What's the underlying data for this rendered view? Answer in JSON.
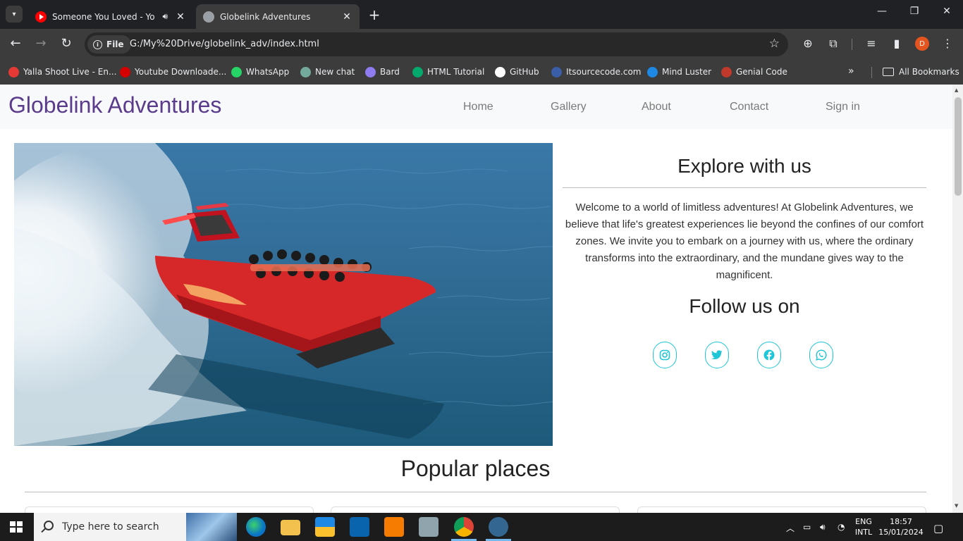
{
  "browser": {
    "tabs": [
      {
        "title": "Someone You Loved - YouTube",
        "active": false,
        "favicon": "youtube-icon",
        "audio": true
      },
      {
        "title": "Globelink Adventures",
        "active": true,
        "favicon": "globe-icon"
      }
    ],
    "address": {
      "chip_label": "File",
      "url": "G:/My%20Drive/globelink_adv/index.html"
    },
    "bookmarks": [
      {
        "label": "Yalla Shoot Live - En...",
        "color": "#e53935"
      },
      {
        "label": "Youtube Downloade...",
        "color": "#d50000"
      },
      {
        "label": "WhatsApp",
        "color": "#25d366"
      },
      {
        "label": "New chat",
        "color": "#74aa9c"
      },
      {
        "label": "Bard",
        "color": "#8e7cf0"
      },
      {
        "label": "HTML Tutorial",
        "color": "#04aa6d"
      },
      {
        "label": "GitHub",
        "color": "#ffffff"
      },
      {
        "label": "Itsourcecode.com",
        "color": "#3b5ea8"
      },
      {
        "label": "Mind Luster",
        "color": "#1e88e5"
      },
      {
        "label": "Genial Code",
        "color": "#c0392b"
      }
    ],
    "all_bookmarks_label": "All Bookmarks",
    "profile_initial": "D"
  },
  "site": {
    "brand": "Globelink Adventures",
    "nav": [
      {
        "label": "Home",
        "active": true
      },
      {
        "label": "Gallery",
        "active": false
      },
      {
        "label": "About",
        "active": false
      },
      {
        "label": "Contact",
        "active": false
      },
      {
        "label": "Sign in",
        "active": false
      }
    ],
    "explore_heading": "Explore with us",
    "explore_text": "Welcome to a world of limitless adventures! At Globelink Adventures, we believe that life's greatest experiences lie beyond the confines of our comfort zones. We invite you to embark on a journey with us, where the ordinary transforms into the extraordinary, and the mundane gives way to the magnificent.",
    "follow_heading": "Follow us on",
    "socials": [
      "instagram-icon",
      "twitter-icon",
      "facebook-icon",
      "whatsapp-icon"
    ],
    "social_color": "#1fc6d6",
    "popular_heading": "Popular places"
  },
  "taskbar": {
    "search_placeholder": "Type here to search",
    "lang_top": "ENG",
    "lang_bottom": "INTL",
    "time": "18:57",
    "date": "15/01/2024"
  }
}
